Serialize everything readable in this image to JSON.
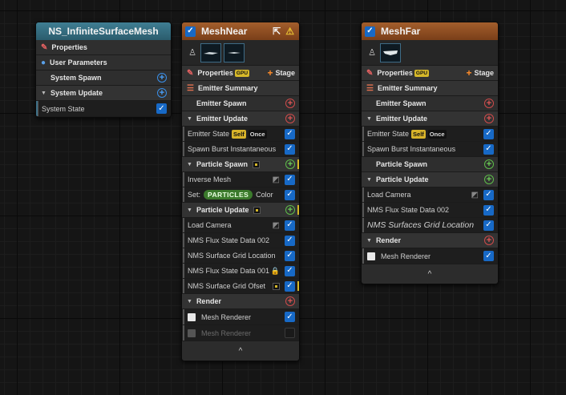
{
  "system": {
    "title": "NS_InfiniteSurfaceMesh",
    "rows": [
      {
        "label": "Properties",
        "icon": "pencil-icon"
      },
      {
        "label": "User Parameters",
        "icon": "user-icon"
      },
      {
        "label": "System Spawn"
      },
      {
        "label": "System Update"
      },
      {
        "label": "System State"
      }
    ]
  },
  "near": {
    "title": "MeshNear",
    "properties": "Properties",
    "gpu": "GPU",
    "stage": "Stage",
    "emitter_summary": "Emitter Summary",
    "emitter_spawn": "Emitter Spawn",
    "emitter_update": "Emitter Update",
    "emitter_state": "Emitter State",
    "self_tag": "Self",
    "once_tag": "Once",
    "spawn_burst": "Spawn Burst Instantaneous",
    "particle_spawn": "Particle Spawn",
    "inverse_mesh": "Inverse Mesh",
    "set_label": "Set:",
    "particles_pill": "PARTICLES",
    "color_label": "Color",
    "particle_update": "Particle Update",
    "load_camera": "Load Camera",
    "flux_002": "NMS Flux State Data 002",
    "surface_grid": "NMS Surface Grid Location",
    "flux_001": "NMS Flux State Data 001",
    "grid_offset": "NMS Surface Grid Ofset",
    "render": "Render",
    "mesh_renderer": "Mesh Renderer",
    "mesh_renderer_disabled": "Mesh Renderer",
    "footer": "^"
  },
  "far": {
    "title": "MeshFar",
    "properties": "Properties",
    "gpu": "GPU",
    "stage": "Stage",
    "emitter_summary": "Emitter Summary",
    "emitter_spawn": "Emitter Spawn",
    "emitter_update": "Emitter Update",
    "emitter_state": "Emitter State",
    "self_tag": "Self",
    "once_tag": "Once",
    "spawn_burst": "Spawn Burst Instantaneous",
    "particle_spawn": "Particle Spawn",
    "particle_update": "Particle Update",
    "load_camera": "Load Camera",
    "flux_002": "NMS Flux State Data 002",
    "surface_grid": "NMS Surfaces Grid Location",
    "render": "Render",
    "mesh_renderer": "Mesh Renderer",
    "footer": "^"
  },
  "colors": {
    "accent_blue": "#1769c6",
    "system_header": "#3f7e93",
    "emitter_header": "#a35e2c",
    "gpu_badge": "#d6b829"
  }
}
